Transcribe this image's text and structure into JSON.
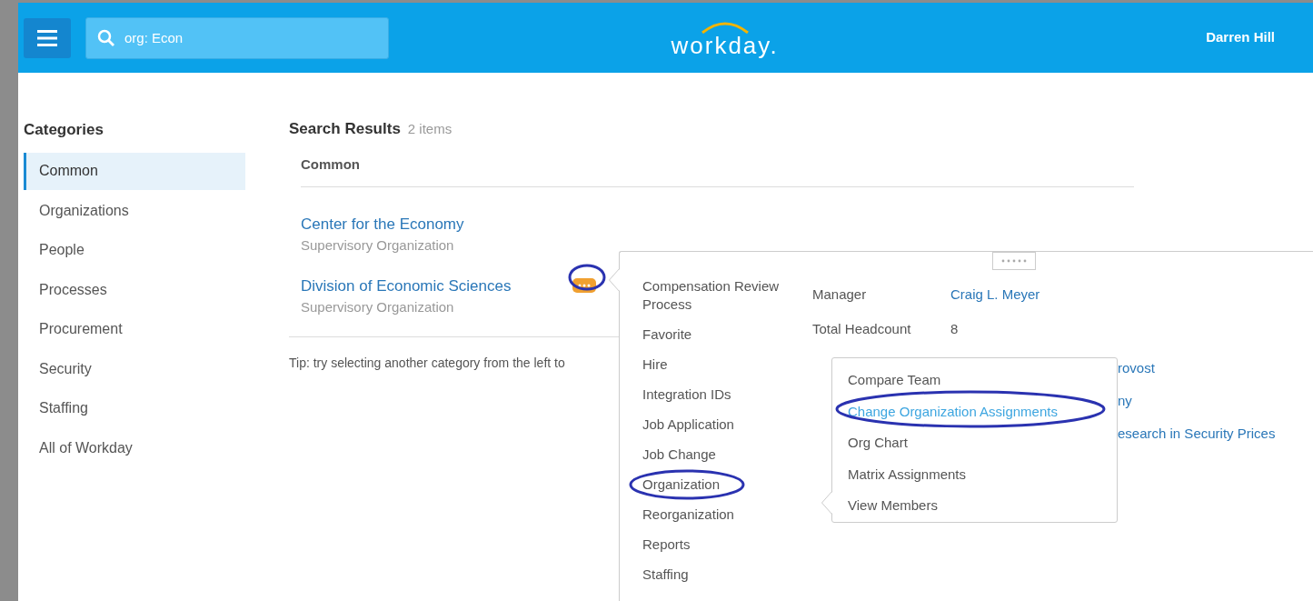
{
  "header": {
    "search_value": "org: Econ",
    "logo": "workday.",
    "user": "Darren Hill"
  },
  "categories": {
    "title": "Categories",
    "items": [
      {
        "label": "Common",
        "selected": true
      },
      {
        "label": "Organizations",
        "selected": false
      },
      {
        "label": "People",
        "selected": false
      },
      {
        "label": "Processes",
        "selected": false
      },
      {
        "label": "Procurement",
        "selected": false
      },
      {
        "label": "Security",
        "selected": false
      },
      {
        "label": "Staffing",
        "selected": false
      },
      {
        "label": "All of Workday",
        "selected": false
      }
    ]
  },
  "results": {
    "title": "Search Results",
    "count": "2 items",
    "section": "Common",
    "items": [
      {
        "name": "Center for the Economy",
        "type": "Supervisory Organization",
        "has_menu": false,
        "circled": false
      },
      {
        "name": "Division of Economic Sciences",
        "type": "Supervisory Organization",
        "has_menu": true,
        "circled": true
      }
    ],
    "tip": "Tip: try selecting another category from the left to"
  },
  "action_menu": {
    "items": [
      {
        "label": "Compensation Review Process",
        "circled": false
      },
      {
        "label": "Favorite",
        "circled": false
      },
      {
        "label": "Hire",
        "circled": false
      },
      {
        "label": "Integration IDs",
        "circled": false
      },
      {
        "label": "Job Application",
        "circled": false
      },
      {
        "label": "Job Change",
        "circled": false
      },
      {
        "label": "Organization",
        "circled": true
      },
      {
        "label": "Reorganization",
        "circled": false
      },
      {
        "label": "Reports",
        "circled": false
      },
      {
        "label": "Staffing",
        "circled": false
      }
    ],
    "details": [
      {
        "label": "Manager",
        "value": "Craig L. Meyer",
        "link": true
      },
      {
        "label": "Total Headcount",
        "value": "8",
        "link": false
      }
    ],
    "partial_links": [
      "rovost",
      "ny",
      "esearch in Security Prices"
    ]
  },
  "submenu": {
    "items": [
      {
        "label": "Compare Team",
        "selected": false,
        "circled": false
      },
      {
        "label": "Change Organization Assignments",
        "selected": true,
        "circled": true
      },
      {
        "label": "Org Chart",
        "selected": false,
        "circled": false
      },
      {
        "label": "Matrix Assignments",
        "selected": false,
        "circled": false
      },
      {
        "label": "View Members",
        "selected": false,
        "circled": false
      }
    ]
  }
}
